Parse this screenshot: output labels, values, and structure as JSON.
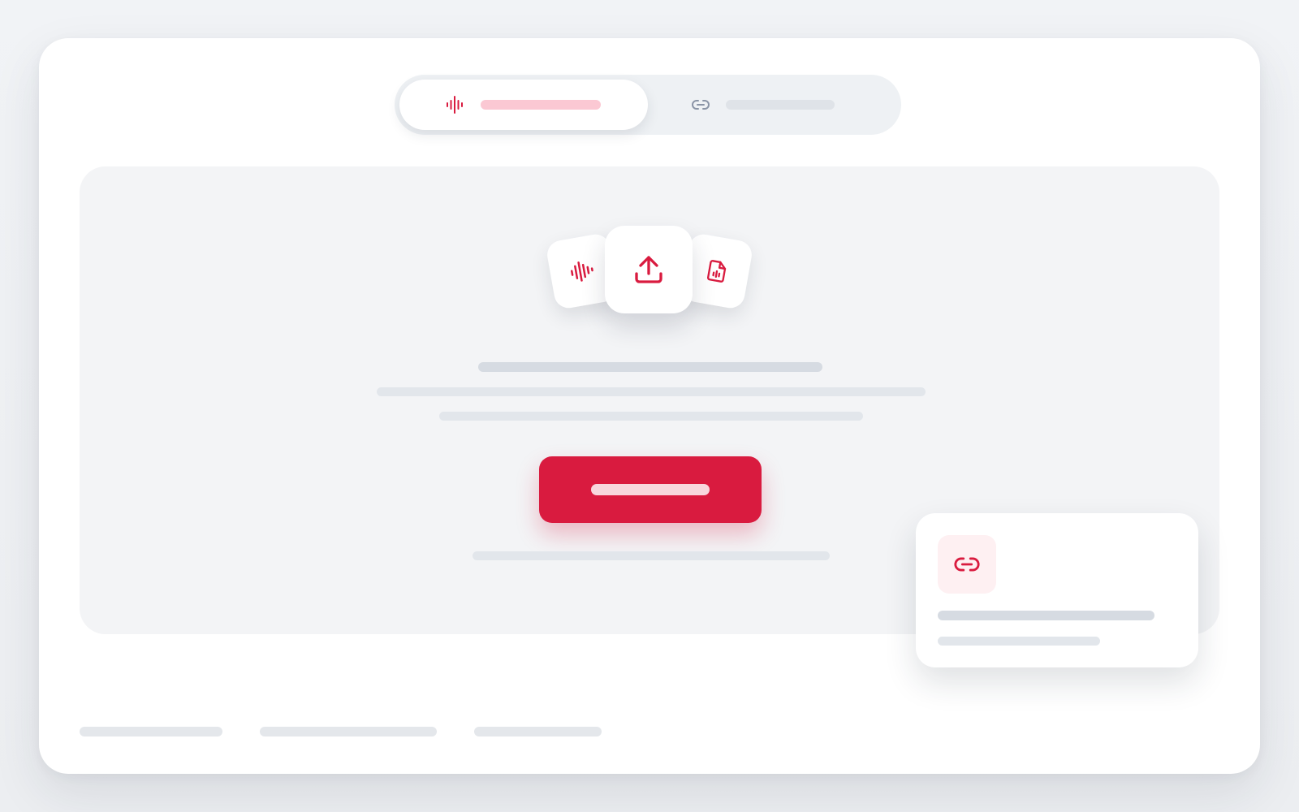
{
  "colors": {
    "accent": "#d91b3f",
    "accent_soft": "#fbc8d3",
    "icon_muted": "#8a94a6"
  },
  "tabs": [
    {
      "icon": "waveform-icon",
      "label": "",
      "active": true
    },
    {
      "icon": "link-icon",
      "label": "",
      "active": false
    }
  ],
  "dropzone": {
    "icons": [
      "waveform-icon",
      "upload-icon",
      "audio-file-icon"
    ],
    "title": "",
    "description": "",
    "button_label": "",
    "hint": ""
  },
  "link_card": {
    "icon": "link-icon",
    "title": "",
    "subtitle": ""
  },
  "footer": {
    "links": [
      "",
      "",
      ""
    ]
  }
}
